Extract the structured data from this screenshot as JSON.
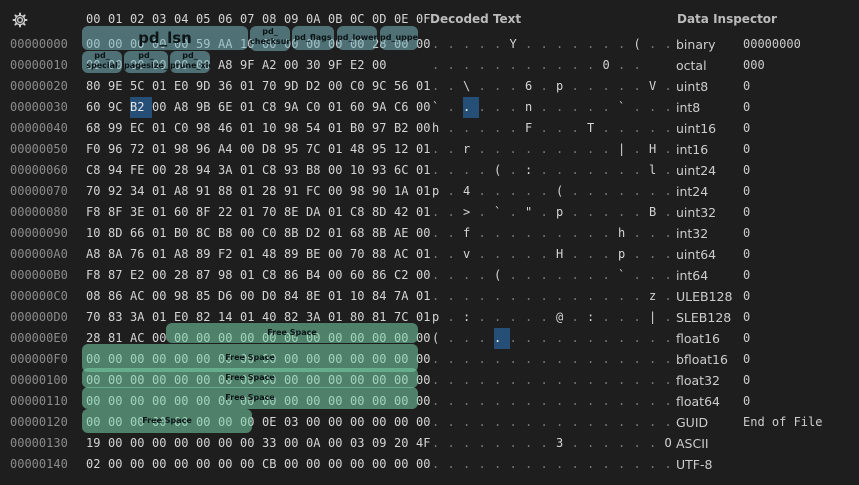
{
  "headers": {
    "hex_columns": [
      "00",
      "01",
      "02",
      "03",
      "04",
      "05",
      "06",
      "07",
      "08",
      "09",
      "0A",
      "0B",
      "0C",
      "0D",
      "0E",
      "0F"
    ],
    "decoded_title": "Decoded Text",
    "inspector_title": "Data Inspector"
  },
  "offsets": [
    "00000000",
    "00000010",
    "00000020",
    "00000030",
    "00000040",
    "00000050",
    "00000060",
    "00000070",
    "00000080",
    "00000090",
    "000000A0",
    "000000B0",
    "000000C0",
    "000000D0",
    "000000E0",
    "000000F0",
    "00000100",
    "00000110",
    "00000120",
    "00000130",
    "00000140"
  ],
  "hex_rows": [
    [
      "00",
      "00",
      "00",
      "00",
      "00",
      "59",
      "AA",
      "10",
      "00",
      "00",
      "00",
      "00",
      "00",
      "28",
      "00",
      "00"
    ],
    [
      "00",
      "00",
      "00",
      "00",
      "00",
      "00",
      "A8",
      "9F",
      "A2",
      "00",
      "30",
      "9F",
      "E2",
      "00",
      "",
      ""
    ],
    [
      "80",
      "9E",
      "5C",
      "01",
      "E0",
      "9D",
      "36",
      "01",
      "70",
      "9D",
      "D2",
      "00",
      "C0",
      "9C",
      "56",
      "01"
    ],
    [
      "60",
      "9C",
      "B2",
      "00",
      "A8",
      "9B",
      "6E",
      "01",
      "C8",
      "9A",
      "C0",
      "01",
      "60",
      "9A",
      "C6",
      "00"
    ],
    [
      "68",
      "99",
      "EC",
      "01",
      "C0",
      "98",
      "46",
      "01",
      "10",
      "98",
      "54",
      "01",
      "B0",
      "97",
      "B2",
      "00"
    ],
    [
      "F0",
      "96",
      "72",
      "01",
      "98",
      "96",
      "A4",
      "00",
      "D8",
      "95",
      "7C",
      "01",
      "48",
      "95",
      "12",
      "01"
    ],
    [
      "C8",
      "94",
      "FE",
      "00",
      "28",
      "94",
      "3A",
      "01",
      "C8",
      "93",
      "B8",
      "00",
      "10",
      "93",
      "6C",
      "01"
    ],
    [
      "70",
      "92",
      "34",
      "01",
      "A8",
      "91",
      "88",
      "01",
      "28",
      "91",
      "FC",
      "00",
      "98",
      "90",
      "1A",
      "01"
    ],
    [
      "F8",
      "8F",
      "3E",
      "01",
      "60",
      "8F",
      "22",
      "01",
      "70",
      "8E",
      "DA",
      "01",
      "C8",
      "8D",
      "42",
      "01"
    ],
    [
      "10",
      "8D",
      "66",
      "01",
      "B0",
      "8C",
      "B8",
      "00",
      "C0",
      "8B",
      "D2",
      "01",
      "68",
      "8B",
      "AE",
      "00"
    ],
    [
      "A8",
      "8A",
      "76",
      "01",
      "A8",
      "89",
      "F2",
      "01",
      "48",
      "89",
      "BE",
      "00",
      "70",
      "88",
      "AC",
      "01"
    ],
    [
      "F8",
      "87",
      "E2",
      "00",
      "28",
      "87",
      "98",
      "01",
      "C8",
      "86",
      "B4",
      "00",
      "60",
      "86",
      "C2",
      "00"
    ],
    [
      "08",
      "86",
      "AC",
      "00",
      "98",
      "85",
      "D6",
      "00",
      "D0",
      "84",
      "8E",
      "01",
      "10",
      "84",
      "7A",
      "01"
    ],
    [
      "70",
      "83",
      "3A",
      "01",
      "E0",
      "82",
      "14",
      "01",
      "40",
      "82",
      "3A",
      "01",
      "80",
      "81",
      "7C",
      "01"
    ],
    [
      "28",
      "81",
      "AC",
      "00",
      "00",
      "00",
      "00",
      "00",
      "00",
      "00",
      "00",
      "00",
      "00",
      "00",
      "00",
      "00"
    ],
    [
      "00",
      "00",
      "00",
      "00",
      "00",
      "00",
      "00",
      "00",
      "00",
      "00",
      "00",
      "00",
      "00",
      "00",
      "00",
      "00"
    ],
    [
      "00",
      "00",
      "00",
      "00",
      "00",
      "00",
      "00",
      "00",
      "00",
      "00",
      "00",
      "00",
      "00",
      "00",
      "00",
      "00"
    ],
    [
      "00",
      "00",
      "00",
      "00",
      "00",
      "00",
      "00",
      "00",
      "00",
      "00",
      "00",
      "00",
      "00",
      "00",
      "00",
      "00"
    ],
    [
      "00",
      "00",
      "00",
      "00",
      "00",
      "00",
      "00",
      "00",
      "0E",
      "03",
      "00",
      "00",
      "00",
      "00",
      "00",
      "00"
    ],
    [
      "19",
      "00",
      "00",
      "00",
      "00",
      "00",
      "00",
      "00",
      "33",
      "00",
      "0A",
      "00",
      "03",
      "09",
      "20",
      "4F"
    ],
    [
      "02",
      "00",
      "00",
      "00",
      "00",
      "00",
      "00",
      "00",
      "CB",
      "00",
      "00",
      "00",
      "00",
      "00",
      "00",
      "00"
    ]
  ],
  "decoded_rows": [
    [
      ".",
      ".",
      ".",
      ".",
      ".",
      "Y",
      ".",
      ".",
      ".",
      ".",
      ".",
      ".",
      ".",
      "(",
      ".",
      "."
    ],
    [
      ".",
      ".",
      ".",
      ".",
      ".",
      ".",
      ".",
      ".",
      ".",
      ".",
      ".",
      "0",
      ".",
      ".",
      "",
      ""
    ],
    [
      ".",
      ".",
      "\\",
      ".",
      ".",
      ".",
      "6",
      ".",
      "p",
      ".",
      ".",
      ".",
      ".",
      ".",
      "V",
      "."
    ],
    [
      "`",
      ".",
      ".",
      ".",
      ".",
      ".",
      "n",
      ".",
      ".",
      ".",
      ".",
      ".",
      "`",
      ".",
      ".",
      "."
    ],
    [
      "h",
      ".",
      ".",
      ".",
      ".",
      ".",
      "F",
      ".",
      ".",
      ".",
      "T",
      ".",
      ".",
      ".",
      ".",
      "."
    ],
    [
      ".",
      ".",
      "r",
      ".",
      ".",
      ".",
      ".",
      ".",
      ".",
      ".",
      ".",
      ".",
      "|",
      ".",
      "H",
      "."
    ],
    [
      ".",
      ".",
      ".",
      ".",
      "(",
      ".",
      ":",
      ".",
      ".",
      ".",
      ".",
      ".",
      ".",
      ".",
      "l",
      "."
    ],
    [
      "p",
      ".",
      "4",
      ".",
      ".",
      ".",
      ".",
      ".",
      "(",
      ".",
      ".",
      ".",
      ".",
      ".",
      ".",
      "."
    ],
    [
      ".",
      ".",
      ">",
      ".",
      "`",
      ".",
      "\"",
      ".",
      "p",
      ".",
      ".",
      ".",
      ".",
      ".",
      "B",
      "."
    ],
    [
      ".",
      ".",
      "f",
      ".",
      ".",
      ".",
      ".",
      ".",
      ".",
      ".",
      ".",
      ".",
      "h",
      ".",
      ".",
      "."
    ],
    [
      ".",
      ".",
      "v",
      ".",
      ".",
      ".",
      ".",
      ".",
      "H",
      ".",
      ".",
      ".",
      "p",
      ".",
      ".",
      "."
    ],
    [
      ".",
      ".",
      ".",
      ".",
      "(",
      ".",
      ".",
      ".",
      ".",
      ".",
      ".",
      ".",
      "`",
      ".",
      ".",
      "."
    ],
    [
      ".",
      ".",
      ".",
      ".",
      ".",
      ".",
      ".",
      ".",
      ".",
      ".",
      ".",
      ".",
      ".",
      ".",
      "z",
      "."
    ],
    [
      "p",
      ".",
      ":",
      ".",
      ".",
      ".",
      ".",
      ".",
      "@",
      ".",
      ":",
      ".",
      ".",
      ".",
      "|",
      "."
    ],
    [
      "(",
      ".",
      ".",
      ".",
      ".",
      ".",
      ".",
      ".",
      ".",
      ".",
      ".",
      ".",
      ".",
      ".",
      ".",
      "."
    ],
    [
      ".",
      ".",
      ".",
      ".",
      ".",
      ".",
      ".",
      ".",
      ".",
      ".",
      ".",
      ".",
      ".",
      ".",
      ".",
      "."
    ],
    [
      ".",
      ".",
      ".",
      ".",
      ".",
      ".",
      ".",
      ".",
      ".",
      ".",
      ".",
      ".",
      ".",
      ".",
      ".",
      "."
    ],
    [
      ".",
      ".",
      ".",
      ".",
      ".",
      ".",
      ".",
      ".",
      ".",
      ".",
      ".",
      ".",
      ".",
      ".",
      ".",
      "."
    ],
    [
      ".",
      ".",
      ".",
      ".",
      ".",
      ".",
      ".",
      ".",
      ".",
      ".",
      ".",
      ".",
      ".",
      ".",
      ".",
      "."
    ],
    [
      ".",
      ".",
      ".",
      ".",
      ".",
      ".",
      ".",
      ".",
      "3",
      ".",
      ".",
      ".",
      ".",
      ".",
      ".",
      "O"
    ],
    [
      ".",
      ".",
      ".",
      ".",
      ".",
      ".",
      ".",
      ".",
      ".",
      ".",
      ".",
      ".",
      ".",
      ".",
      ".",
      "."
    ]
  ],
  "selection": {
    "hex_row": 3,
    "hex_col": 2,
    "decoded_cells": [
      [
        3,
        2
      ],
      [
        14,
        4
      ]
    ]
  },
  "inspector": [
    {
      "k": "binary",
      "v": "00000000"
    },
    {
      "k": "octal",
      "v": "000"
    },
    {
      "k": "uint8",
      "v": "0"
    },
    {
      "k": "int8",
      "v": "0"
    },
    {
      "k": "uint16",
      "v": "0"
    },
    {
      "k": "int16",
      "v": "0"
    },
    {
      "k": "uint24",
      "v": "0"
    },
    {
      "k": "int24",
      "v": "0"
    },
    {
      "k": "uint32",
      "v": "0"
    },
    {
      "k": "int32",
      "v": "0"
    },
    {
      "k": "uint64",
      "v": "0"
    },
    {
      "k": "int64",
      "v": "0"
    },
    {
      "k": "ULEB128",
      "v": "0"
    },
    {
      "k": "SLEB128",
      "v": "0"
    },
    {
      "k": "float16",
      "v": "0"
    },
    {
      "k": "bfloat16",
      "v": "0"
    },
    {
      "k": "float32",
      "v": "0"
    },
    {
      "k": "float64",
      "v": "0"
    },
    {
      "k": "GUID",
      "v": "End of File"
    },
    {
      "k": "ASCII",
      "v": ""
    },
    {
      "k": "UTF-8",
      "v": ""
    }
  ],
  "overlays": {
    "pd_lsn": "pd_lsn",
    "pd_checksum": "pd_\nchecksum",
    "pd_flags": "pd_flags",
    "pd_lower": "pd_lower",
    "pd_upper": "pd_upper",
    "pd_special": "pd_\nspecial",
    "pd_pagesize_version": "pd_\npagesize_version",
    "pd_prune_xid": "pd_\nprune_xid",
    "free_space": "Free Space"
  },
  "colors": {
    "selection": "#264f78",
    "struct_overlay": "#78b4be",
    "free_overlay": "#78d2aa"
  }
}
